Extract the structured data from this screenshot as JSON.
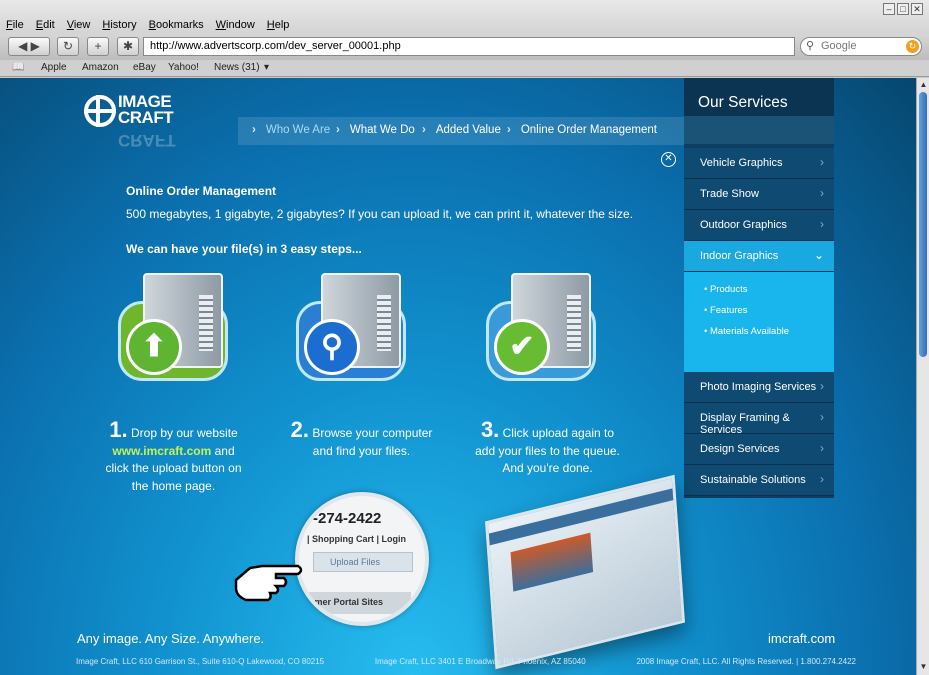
{
  "browser": {
    "menu": [
      "File",
      "Edit",
      "View",
      "History",
      "Bookmarks",
      "Window",
      "Help"
    ],
    "url": "http://www.advertscorp.com/dev_server_00001.php",
    "search_placeholder": "Google",
    "bookmarks": [
      "Apple",
      "Amazon",
      "eBay",
      "Yahoo!",
      "News (31)"
    ]
  },
  "logo": {
    "line1": "IMAGE",
    "line2": "CRAFT"
  },
  "topnav": [
    "Who We Are",
    "What We Do",
    "Added Value",
    "Online Order Management"
  ],
  "content": {
    "title": "Online Order Management",
    "desc": "500 megabytes, 1 gigabyte, 2 gigabytes? If you can upload it, we can print it, whatever the size.",
    "sub": "We can have your file(s) in 3 easy steps..."
  },
  "steps": [
    {
      "num": "1.",
      "text_a": "Drop by our website",
      "link": "www.imcraft.com",
      "text_b": " and click the upload button on the home page."
    },
    {
      "num": "2.",
      "text_a": "Browse your computer and find your files."
    },
    {
      "num": "3.",
      "text_a": "Click upload again to add your files to the queue. And you're done."
    }
  ],
  "sidebar": {
    "title": "Our Services",
    "items_top": [
      "Vehicle Graphics",
      "Trade Show",
      "Outdoor Graphics"
    ],
    "open_item": "Indoor Graphics",
    "sub_items": [
      "• Products",
      "• Features",
      "• Materials Available"
    ],
    "items_bottom": [
      "Photo Imaging Services",
      "Display Framing & Services",
      "Design Services",
      "Sustainable Solutions"
    ]
  },
  "magnifier": {
    "phone": "-274-2422",
    "links": "|  Shopping Cart  |  Login",
    "upload": "Upload Files",
    "portal": "omer Portal Sites"
  },
  "tagline": "Any image. Any Size. Anywhere.",
  "domain": "imcraft.com",
  "footer": [
    "Image Craft, LLC   610 Garrison St., Suite 610-Q Lakewood, CO 80215",
    "Image Craft, LLC   3401 E Broadway Rd. Phoenix, AZ 85040",
    "2008 Image Craft, LLC. All Rights Reserved.  |  1.800.274.2422"
  ]
}
